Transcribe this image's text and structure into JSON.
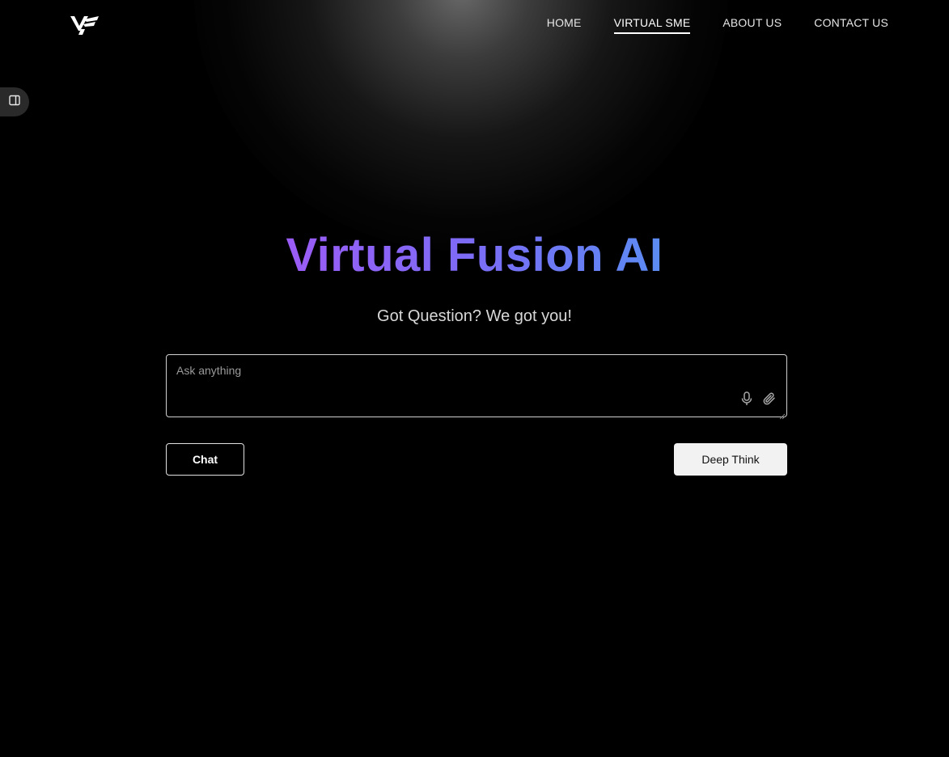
{
  "brand": {
    "logo_icon": "vf-logo-icon"
  },
  "nav": {
    "items": [
      {
        "label": "HOME",
        "active": false
      },
      {
        "label": "VIRTUAL SME",
        "active": true
      },
      {
        "label": "ABOUT US",
        "active": false
      },
      {
        "label": "CONTACT US",
        "active": false
      }
    ]
  },
  "sidebar_toggle": {
    "icon": "sidebar-toggle-icon"
  },
  "hero": {
    "title": "Virtual Fusion AI",
    "subtitle": "Got Question? We got you!"
  },
  "prompt": {
    "placeholder": "Ask anything",
    "value": "",
    "mic_icon": "microphone-icon",
    "attach_icon": "paperclip-icon"
  },
  "actions": {
    "chat_label": "Chat",
    "deep_think_label": "Deep Think"
  },
  "colors": {
    "background": "#000000",
    "title_gradient_start": "#9b5cf6",
    "title_gradient_end": "#5b8cf3",
    "deep_think_bg": "#f2f2f2"
  }
}
